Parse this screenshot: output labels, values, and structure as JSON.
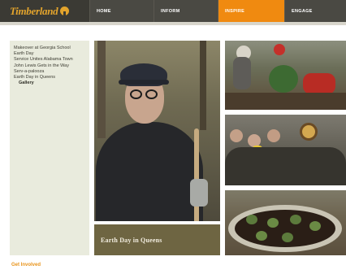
{
  "brand": {
    "logo_text": "Timberland",
    "accent_color": "#f08a10",
    "logo_color": "#e3a42c",
    "logo_icon": "tree-icon"
  },
  "nav": {
    "items": [
      {
        "label": "HOME",
        "active": false
      },
      {
        "label": "INFORM",
        "active": false
      },
      {
        "label": "INSPIRE",
        "active": true
      },
      {
        "label": "ENGAGE",
        "active": false
      }
    ]
  },
  "sidebar": {
    "items": [
      {
        "label": "Makeover at Georgia School"
      },
      {
        "label": "Earth Day"
      },
      {
        "label": "Service Unites Alabama Town"
      },
      {
        "label": "John Lewis Gets in the Way"
      },
      {
        "label": "Serv-a-palooza"
      },
      {
        "label": "Earth Day in Queens"
      },
      {
        "label": "Gallery"
      }
    ]
  },
  "gallery": {
    "caption": "Earth Day in Queens"
  },
  "footer": {
    "cta": "Get Involved"
  }
}
